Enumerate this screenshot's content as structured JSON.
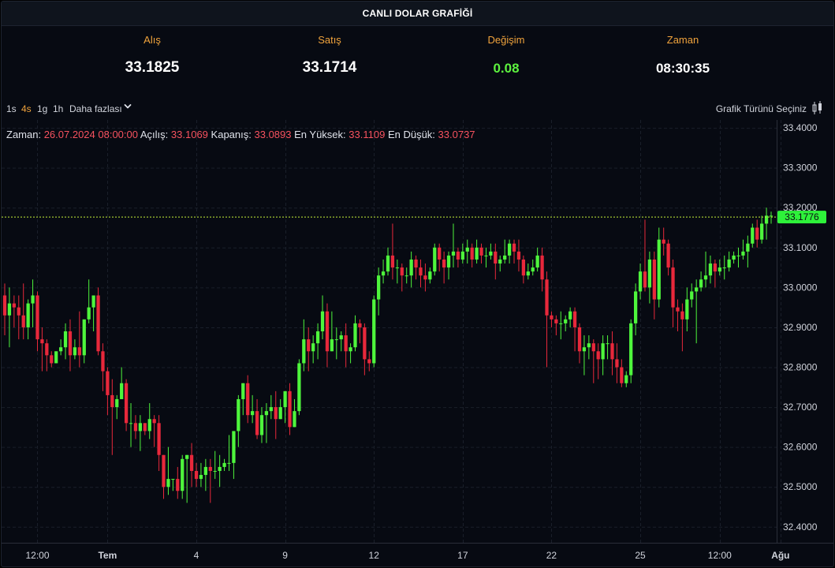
{
  "header": {
    "title": "CANLI DOLAR GRAFİĞİ"
  },
  "stats": [
    {
      "label": "Alış",
      "value": "33.1825"
    },
    {
      "label": "Satış",
      "value": "33.1714"
    },
    {
      "label": "Değişim",
      "value": "0.08"
    },
    {
      "label": "Zaman",
      "value": "08:30:35"
    }
  ],
  "toolbar": {
    "intervals": [
      "1s",
      "4s",
      "1g",
      "1h"
    ],
    "active_interval": "4s",
    "more_label": "Daha fazlası",
    "chart_type_label": "Grafik Türünü Seçiniz"
  },
  "ohlc": {
    "time_label": "Zaman:",
    "time_value": "26.07.2024 08:00:00",
    "open_label": "Açılış:",
    "open_value": "33.1069",
    "close_label": "Kapanış:",
    "close_value": "33.0893",
    "high_label": "En Yüksek:",
    "high_value": "33.1109",
    "low_label": "En Düşük:",
    "low_value": "33.0737"
  },
  "colors": {
    "up": "#4ef53c",
    "down": "#e8283b",
    "accent": "#f0a33c",
    "price_line": "#c6f23a",
    "price_tag": "#2ef23a"
  },
  "chart_data": {
    "type": "candlestick",
    "title": "",
    "ylim": [
      32.36,
      33.42
    ],
    "y_ticks": [
      33.4,
      33.3,
      33.2,
      33.1,
      33.0,
      32.9,
      32.8,
      32.7,
      32.6,
      32.5,
      32.4
    ],
    "y_tick_labels": [
      "33.4000",
      "33.3000",
      "33.2000",
      "33.1000",
      "33.0000",
      "32.9000",
      "32.8000",
      "32.7000",
      "32.6000",
      "32.5000",
      "32.4000"
    ],
    "x_ticks": [
      "12:00",
      "Tem",
      "4",
      "9",
      "12",
      "17",
      "22",
      "25",
      "12:00",
      "Ağu"
    ],
    "x_tick_candle_index": [
      7,
      22,
      41,
      60,
      79,
      98,
      117,
      136,
      153,
      166
    ],
    "last_price": 33.1776,
    "last_price_label": "33.1776",
    "grid": true,
    "candles": [
      [
        32.98,
        32.93,
        33.01,
        32.88
      ],
      [
        32.93,
        32.96,
        33.0,
        32.85
      ],
      [
        32.96,
        32.95,
        32.98,
        32.9
      ],
      [
        32.95,
        32.93,
        32.98,
        32.87
      ],
      [
        32.93,
        32.9,
        33.01,
        32.87
      ],
      [
        32.9,
        32.96,
        32.97,
        32.87
      ],
      [
        32.96,
        32.98,
        33.02,
        32.9
      ],
      [
        32.98,
        32.87,
        32.99,
        32.84
      ],
      [
        32.87,
        32.86,
        32.9,
        32.79
      ],
      [
        32.86,
        32.83,
        32.87,
        32.79
      ],
      [
        32.83,
        32.81,
        32.84,
        32.8
      ],
      [
        32.81,
        32.84,
        32.84,
        32.81
      ],
      [
        32.84,
        32.85,
        32.87,
        32.83
      ],
      [
        32.85,
        32.89,
        32.91,
        32.82
      ],
      [
        32.89,
        32.83,
        32.92,
        32.79
      ],
      [
        32.83,
        32.85,
        32.87,
        32.82
      ],
      [
        32.85,
        32.83,
        32.94,
        32.8
      ],
      [
        32.83,
        32.92,
        32.92,
        32.81
      ],
      [
        32.92,
        32.95,
        33.02,
        32.91
      ],
      [
        32.95,
        32.98,
        32.98,
        32.89
      ],
      [
        32.98,
        32.84,
        33.0,
        32.83
      ],
      [
        32.84,
        32.79,
        32.86,
        32.74
      ],
      [
        32.79,
        32.73,
        32.8,
        32.68
      ],
      [
        32.73,
        32.7,
        32.77,
        32.58
      ],
      [
        32.7,
        32.72,
        32.73,
        32.67
      ],
      [
        32.72,
        32.76,
        32.8,
        32.72
      ],
      [
        32.76,
        32.66,
        32.77,
        32.64
      ],
      [
        32.66,
        32.66,
        32.71,
        32.6
      ],
      [
        32.66,
        32.64,
        32.68,
        32.62
      ],
      [
        32.64,
        32.66,
        32.68,
        32.59
      ],
      [
        32.66,
        32.64,
        32.66,
        32.63
      ],
      [
        32.64,
        32.67,
        32.71,
        32.62
      ],
      [
        32.67,
        32.66,
        32.68,
        32.6
      ],
      [
        32.66,
        32.58,
        32.68,
        32.54
      ],
      [
        32.58,
        32.5,
        32.58,
        32.47
      ],
      [
        32.5,
        32.52,
        32.6,
        32.48
      ],
      [
        32.52,
        32.52,
        32.52,
        32.49
      ],
      [
        32.52,
        32.49,
        32.55,
        32.47
      ],
      [
        32.49,
        32.57,
        32.58,
        32.47
      ],
      [
        32.57,
        32.58,
        32.58,
        32.46
      ],
      [
        32.58,
        32.54,
        32.61,
        32.5
      ],
      [
        32.54,
        32.52,
        32.56,
        32.5
      ],
      [
        32.52,
        32.53,
        32.56,
        32.5
      ],
      [
        32.53,
        32.55,
        32.57,
        32.49
      ],
      [
        32.55,
        32.54,
        32.57,
        32.46
      ],
      [
        32.54,
        32.54,
        32.59,
        32.52
      ],
      [
        32.54,
        32.55,
        32.58,
        32.5
      ],
      [
        32.55,
        32.56,
        32.57,
        32.54
      ],
      [
        32.56,
        32.56,
        32.63,
        32.54
      ],
      [
        32.56,
        32.64,
        32.64,
        32.52
      ],
      [
        32.64,
        32.72,
        32.73,
        32.6
      ],
      [
        32.72,
        32.76,
        32.76,
        32.68
      ],
      [
        32.76,
        32.68,
        32.78,
        32.66
      ],
      [
        32.68,
        32.69,
        32.73,
        32.66
      ],
      [
        32.69,
        32.63,
        32.72,
        32.62
      ],
      [
        32.63,
        32.68,
        32.7,
        32.61
      ],
      [
        32.68,
        32.69,
        32.71,
        32.61
      ],
      [
        32.69,
        32.7,
        32.73,
        32.67
      ],
      [
        32.7,
        32.67,
        32.74,
        32.62
      ],
      [
        32.67,
        32.7,
        32.72,
        32.67
      ],
      [
        32.7,
        32.74,
        32.74,
        32.66
      ],
      [
        32.74,
        32.65,
        32.76,
        32.63
      ],
      [
        32.65,
        32.69,
        32.72,
        32.65
      ],
      [
        32.69,
        32.81,
        32.82,
        32.68
      ],
      [
        32.81,
        32.87,
        32.92,
        32.79
      ],
      [
        32.87,
        32.84,
        32.9,
        32.79
      ],
      [
        32.84,
        32.86,
        32.88,
        32.81
      ],
      [
        32.86,
        32.89,
        32.91,
        32.82
      ],
      [
        32.89,
        32.94,
        32.98,
        32.87
      ],
      [
        32.94,
        32.84,
        32.96,
        32.8
      ],
      [
        32.84,
        32.87,
        32.94,
        32.84
      ],
      [
        32.87,
        32.87,
        32.9,
        32.82
      ],
      [
        32.87,
        32.88,
        32.89,
        32.84
      ],
      [
        32.88,
        32.84,
        32.91,
        32.8
      ],
      [
        32.84,
        32.85,
        32.86,
        32.81
      ],
      [
        32.85,
        32.91,
        32.93,
        32.84
      ],
      [
        32.91,
        32.9,
        32.92,
        32.86
      ],
      [
        32.9,
        32.82,
        32.91,
        32.78
      ],
      [
        32.82,
        32.81,
        32.84,
        32.79
      ],
      [
        32.81,
        32.97,
        32.98,
        32.8
      ],
      [
        32.97,
        33.03,
        33.05,
        32.93
      ],
      [
        33.03,
        33.04,
        33.07,
        33.01
      ],
      [
        33.04,
        33.08,
        33.1,
        33.03
      ],
      [
        33.08,
        33.05,
        33.16,
        33.02
      ],
      [
        33.05,
        33.05,
        33.07,
        33.01
      ],
      [
        33.05,
        33.03,
        33.06,
        32.99
      ],
      [
        33.03,
        33.03,
        33.05,
        33.01
      ],
      [
        33.03,
        33.07,
        33.09,
        33.0
      ],
      [
        33.07,
        33.05,
        33.08,
        33.02
      ],
      [
        33.05,
        33.03,
        33.07,
        33.0
      ],
      [
        33.03,
        33.02,
        33.06,
        32.99
      ],
      [
        33.02,
        33.04,
        33.05,
        33.01
      ],
      [
        33.04,
        33.1,
        33.11,
        33.03
      ],
      [
        33.1,
        33.07,
        33.11,
        33.04
      ],
      [
        33.07,
        33.05,
        33.09,
        33.01
      ],
      [
        33.05,
        33.08,
        33.09,
        33.02
      ],
      [
        33.08,
        33.09,
        33.16,
        33.05
      ],
      [
        33.09,
        33.07,
        33.1,
        33.05
      ],
      [
        33.07,
        33.09,
        33.11,
        33.06
      ],
      [
        33.09,
        33.1,
        33.12,
        33.06
      ],
      [
        33.1,
        33.07,
        33.11,
        33.05
      ],
      [
        33.07,
        33.1,
        33.12,
        33.06
      ],
      [
        33.1,
        33.08,
        33.11,
        33.06
      ],
      [
        33.08,
        33.08,
        33.1,
        33.05
      ],
      [
        33.08,
        33.09,
        33.11,
        33.07
      ],
      [
        33.09,
        33.06,
        33.11,
        33.02
      ],
      [
        33.06,
        33.07,
        33.08,
        33.04
      ],
      [
        33.07,
        33.08,
        33.12,
        33.06
      ],
      [
        33.08,
        33.11,
        33.12,
        33.06
      ],
      [
        33.11,
        33.09,
        33.12,
        33.06
      ],
      [
        33.09,
        33.07,
        33.12,
        33.04
      ],
      [
        33.07,
        33.03,
        33.08,
        33.01
      ],
      [
        33.03,
        33.04,
        33.06,
        33.02
      ],
      [
        33.04,
        33.05,
        33.07,
        33.03
      ],
      [
        33.05,
        33.08,
        33.1,
        33.04
      ],
      [
        33.08,
        33.02,
        33.1,
        32.99
      ],
      [
        33.02,
        32.93,
        33.04,
        32.8
      ],
      [
        32.93,
        32.92,
        32.94,
        32.9
      ],
      [
        32.92,
        32.91,
        32.93,
        32.88
      ],
      [
        32.91,
        32.91,
        32.94,
        32.87
      ],
      [
        32.91,
        32.92,
        32.93,
        32.89
      ],
      [
        32.92,
        32.94,
        32.95,
        32.9
      ],
      [
        32.94,
        32.9,
        32.95,
        32.84
      ],
      [
        32.9,
        32.84,
        32.91,
        32.81
      ],
      [
        32.84,
        32.85,
        32.88,
        32.78
      ],
      [
        32.85,
        32.86,
        32.88,
        32.82
      ],
      [
        32.86,
        32.84,
        32.87,
        32.76
      ],
      [
        32.84,
        32.82,
        32.86,
        32.77
      ],
      [
        32.82,
        32.86,
        32.88,
        32.78
      ],
      [
        32.86,
        32.86,
        32.88,
        32.82
      ],
      [
        32.86,
        32.82,
        32.89,
        32.78
      ],
      [
        32.82,
        32.8,
        32.86,
        32.76
      ],
      [
        32.8,
        32.76,
        32.82,
        32.75
      ],
      [
        32.76,
        32.78,
        32.79,
        32.75
      ],
      [
        32.78,
        32.91,
        32.92,
        32.76
      ],
      [
        32.91,
        32.99,
        33.01,
        32.88
      ],
      [
        32.99,
        33.04,
        33.06,
        32.97
      ],
      [
        33.04,
        33.0,
        33.17,
        32.99
      ],
      [
        33.0,
        33.07,
        33.09,
        32.96
      ],
      [
        33.07,
        32.97,
        33.09,
        32.92
      ],
      [
        32.97,
        33.12,
        33.15,
        32.95
      ],
      [
        33.12,
        33.11,
        33.15,
        33.08
      ],
      [
        33.11,
        33.05,
        33.12,
        33.03
      ],
      [
        33.05,
        32.95,
        33.07,
        32.9
      ],
      [
        32.95,
        32.94,
        32.97,
        32.89
      ],
      [
        32.94,
        32.92,
        32.96,
        32.84
      ],
      [
        32.92,
        32.97,
        33.0,
        32.89
      ],
      [
        32.97,
        32.99,
        33.01,
        32.95
      ],
      [
        32.99,
        33.0,
        33.02,
        32.86
      ],
      [
        33.0,
        33.02,
        33.04,
        32.99
      ],
      [
        33.02,
        33.03,
        33.09,
        33.0
      ],
      [
        33.03,
        33.06,
        33.08,
        33.01
      ],
      [
        33.06,
        33.04,
        33.07,
        33.0
      ],
      [
        33.04,
        33.05,
        33.07,
        33.03
      ],
      [
        33.05,
        33.05,
        33.08,
        33.02
      ],
      [
        33.05,
        33.07,
        33.09,
        33.04
      ],
      [
        33.07,
        33.08,
        33.09,
        33.06
      ],
      [
        33.08,
        33.08,
        33.1,
        33.05
      ],
      [
        33.08,
        33.09,
        33.12,
        33.07
      ],
      [
        33.09,
        33.11,
        33.13,
        33.05
      ],
      [
        33.11,
        33.15,
        33.16,
        33.1
      ],
      [
        33.15,
        33.12,
        33.17,
        33.1
      ],
      [
        33.12,
        33.16,
        33.18,
        33.11
      ],
      [
        33.16,
        33.18,
        33.2,
        33.12
      ],
      [
        33.18,
        33.18,
        33.19,
        33.16
      ]
    ]
  }
}
